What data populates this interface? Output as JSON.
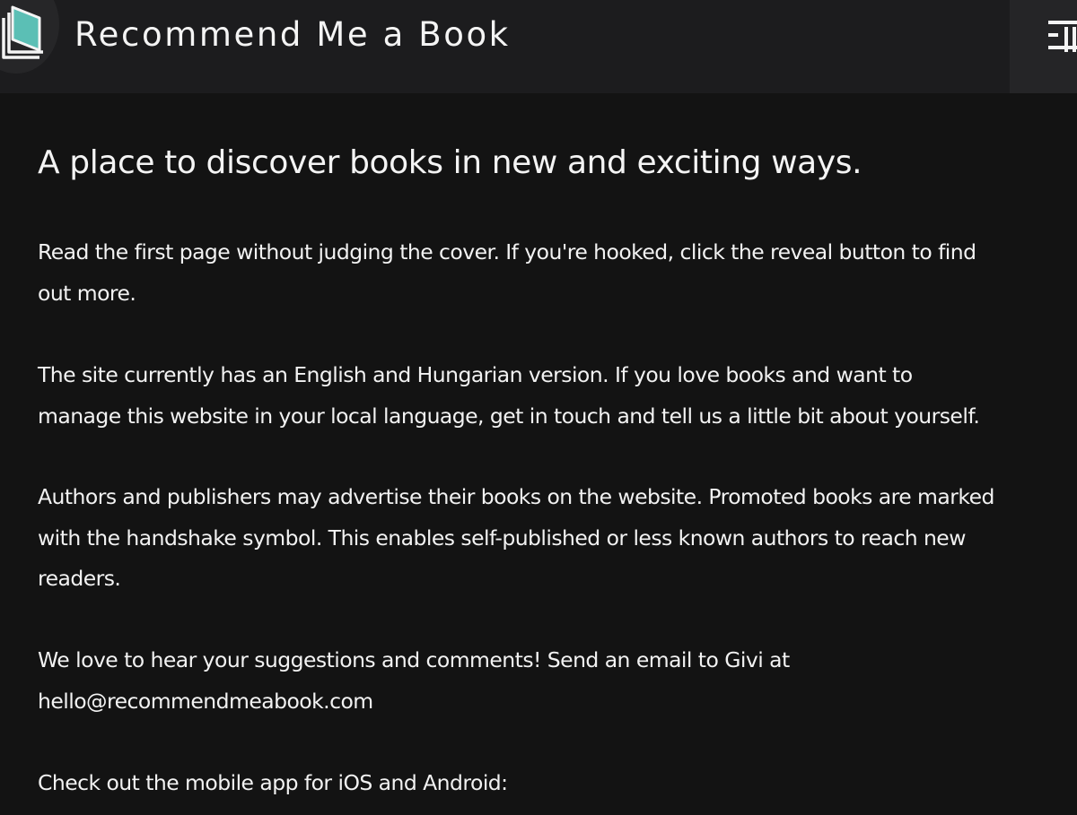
{
  "header": {
    "title": "Recommend Me a Book",
    "logo_icon": "book-logo-icon",
    "menu_icon": "hamburger-menu-icon"
  },
  "main": {
    "headline": "A place to discover books in new and exciting ways.",
    "paragraphs": [
      {
        "lines": [
          "Read the first page without judging the cover. If you're hooked, click the reveal button to find",
          "out more."
        ]
      },
      {
        "lines": [
          "The site currently has an English and Hungarian version. If you love books and want to",
          "manage this website in your local language, get in touch and tell us a little bit about yourself."
        ]
      },
      {
        "lines": [
          "Authors and publishers may advertise their books on the website. Promoted books are marked",
          "with the handshake symbol. This enables self-published or less known authors to reach new",
          "readers."
        ]
      },
      {
        "lines": [
          "We love to hear your suggestions and comments! Send an email to Givi at",
          "hello@recommendmeabook.com"
        ]
      },
      {
        "lines": [
          "Check out the mobile app for iOS and Android:"
        ]
      }
    ]
  },
  "colors": {
    "background": "#131313",
    "header": "#1c1c1e",
    "logo_accent": "#5bbfb5",
    "text": "#f2f2f2"
  }
}
